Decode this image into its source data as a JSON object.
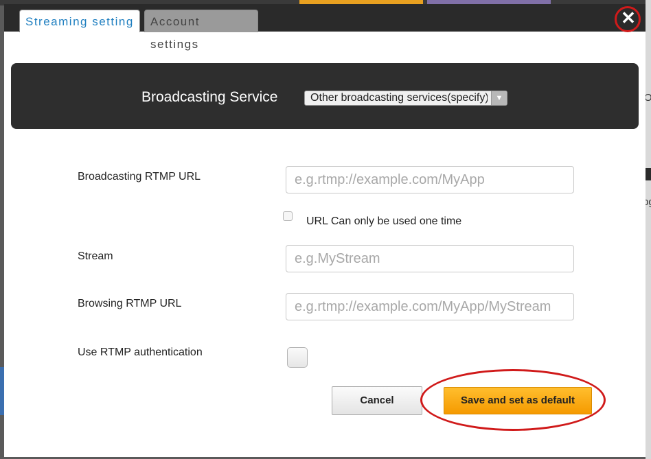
{
  "tabs": {
    "streaming": "Streaming setting",
    "account": "Account settings"
  },
  "close": {
    "glyph": "✕"
  },
  "service": {
    "label": "Broadcasting Service",
    "selected": "Other broadcasting services(specify)"
  },
  "fields": {
    "rtmp_url": {
      "label": "Broadcasting RTMP URL",
      "placeholder": "e.g.rtmp://example.com/MyApp",
      "value": ""
    },
    "one_time": {
      "label": "URL Can only be used one time",
      "checked": false
    },
    "stream": {
      "label": "Stream",
      "placeholder": "e.g.MyStream",
      "value": ""
    },
    "browsing_url": {
      "label": "Browsing RTMP URL",
      "placeholder": "e.g.rtmp://example.com/MyApp/MyStream",
      "value": ""
    },
    "auth": {
      "label": "Use RTMP authentication",
      "checked": false
    }
  },
  "buttons": {
    "cancel": "Cancel",
    "save": "Save and set as default"
  },
  "background": {
    "right_text_1": "Op",
    "right_text_2": "pg"
  },
  "colors": {
    "tab_active_text": "#1f7fc0",
    "save_button": "#f9a80f",
    "annotation": "#d01a1a",
    "service_panel": "#2e2e2e"
  }
}
